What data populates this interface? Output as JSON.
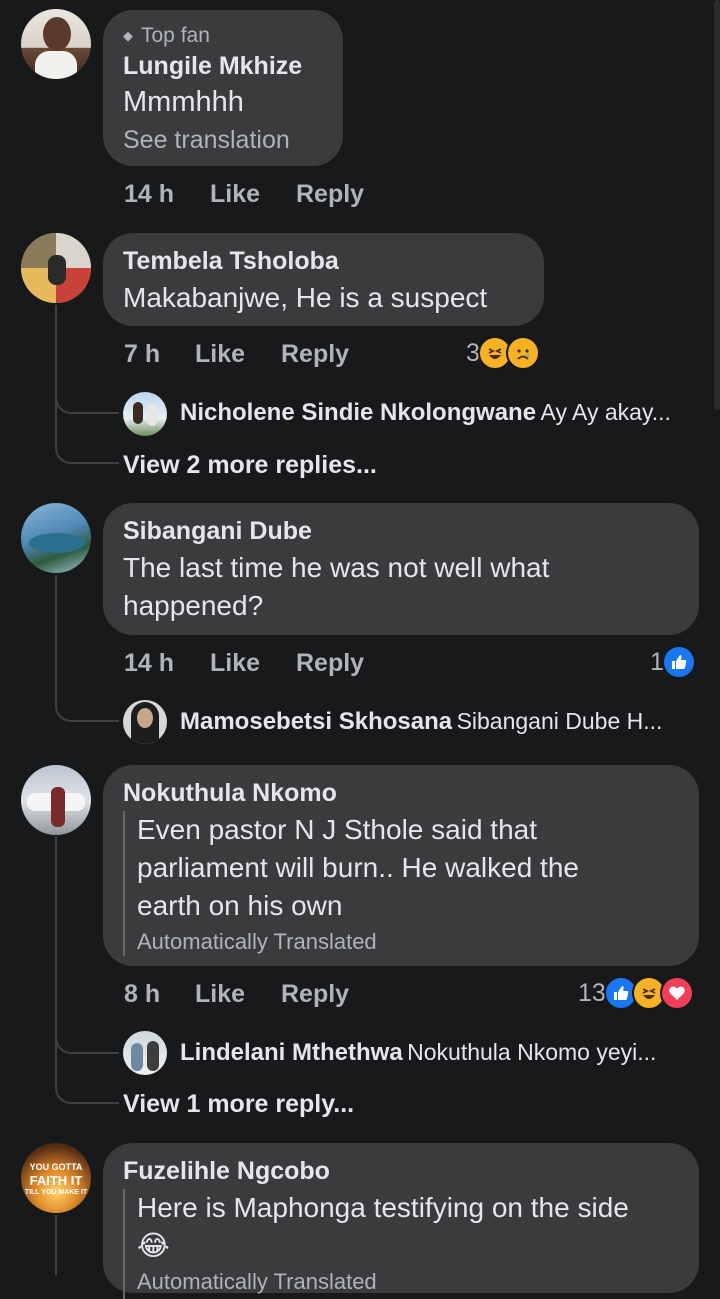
{
  "comments": [
    {
      "badge": "Top fan",
      "name": "Lungile Mkhize",
      "text": "Mmmhhh",
      "see_translation": "See translation",
      "time": "14 h",
      "like": "Like",
      "reply": "Reply"
    },
    {
      "name": "Tembela Tsholoba",
      "text": "Makabanjwe, He is a suspect",
      "time": "7 h",
      "like": "Like",
      "reply": "Reply",
      "reaction_count": "3",
      "reactions": [
        "haha-icon",
        "sad-icon"
      ],
      "replies": [
        {
          "name": "Nicholene Sindie Nkolongwane",
          "text": "Ay Ay akay..."
        }
      ],
      "more_replies": "View 2 more replies..."
    },
    {
      "name": "Sibangani Dube",
      "text_line1": "The last time he was not well what",
      "text_line2": "happened?",
      "time": "14 h",
      "like": "Like",
      "reply": "Reply",
      "reaction_count": "1",
      "reactions": [
        "like-icon"
      ],
      "replies": [
        {
          "name": "Mamosebetsi Skhosana",
          "text": "Sibangani Dube H..."
        }
      ]
    },
    {
      "name": "Nokuthula Nkomo",
      "text_line1": "Even pastor N J Sthole said that",
      "text_line2": "parliament will burn.. He walked the",
      "text_line3": "earth on his own",
      "auto_translated": "Automatically Translated",
      "time": "8 h",
      "like": "Like",
      "reply": "Reply",
      "reaction_count": "13",
      "reactions": [
        "like-icon",
        "haha-icon",
        "love-icon"
      ],
      "replies": [
        {
          "name": "Lindelani Mthethwa",
          "text": "Nokuthula Nkomo yeyi..."
        }
      ],
      "more_replies": "View 1 more reply..."
    },
    {
      "name": "Fuzelihle Ngcobo",
      "text_line1": "Here is Maphonga testifying on the side",
      "emoji": "😂",
      "auto_translated": "Automatically Translated",
      "avatar_text": [
        "YOU GOTTA",
        "FAITH IT",
        "TILL YOU MAKE IT"
      ]
    }
  ],
  "colors": {
    "background": "#18191a",
    "bubble": "#3a3b3c",
    "text": "#e4e6eb",
    "meta": "#b0b3b8",
    "like_blue": "#1877f2",
    "love_red": "#f33e58",
    "haha_yellow": "#f7b125"
  }
}
